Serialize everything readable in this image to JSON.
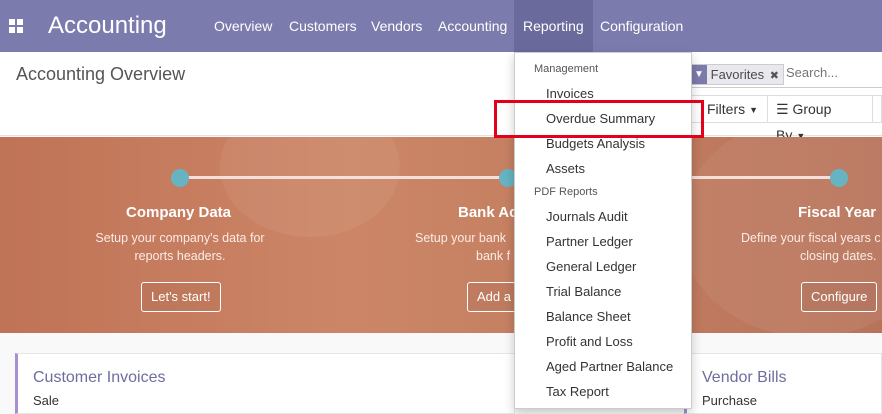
{
  "navbar": {
    "app_title": "Accounting",
    "menu": [
      "Overview",
      "Customers",
      "Vendors",
      "Accounting",
      "Reporting",
      "Configuration"
    ],
    "active_menu": "Reporting"
  },
  "control_panel": {
    "title": "Accounting Overview",
    "search": {
      "facet_label": "Favorites",
      "placeholder": "Search..."
    },
    "filters_label": "Filters",
    "group_by_label": "Group By"
  },
  "onboarding": {
    "steps": [
      {
        "title": "Company Data",
        "desc_line1": "Setup your company's data for",
        "desc_line2": "reports headers.",
        "button": "Let's start!"
      },
      {
        "title": "Bank Ac",
        "desc_line1": "Setup your bank",
        "desc_line2": "bank f",
        "button": "Add a"
      },
      {
        "title": "Fiscal Year",
        "desc_line1": "Define your fiscal years c",
        "desc_line2": "closing dates.",
        "button": "Configure"
      }
    ]
  },
  "dashboard": {
    "cards": [
      {
        "title": "Customer Invoices",
        "subtitle": "Sale"
      },
      {
        "title": "Vendor Bills",
        "subtitle": "Purchase"
      }
    ]
  },
  "reporting_menu": {
    "sections": [
      {
        "header": "Management",
        "items": [
          "Invoices",
          "Overdue Summary",
          "Budgets Analysis",
          "Assets"
        ]
      },
      {
        "header": "PDF Reports",
        "items": [
          "Journals Audit",
          "Partner Ledger",
          "General Ledger",
          "Trial Balance",
          "Balance Sheet",
          "Profit and Loss",
          "Aged Partner Balance",
          "Tax Report"
        ]
      }
    ],
    "highlighted_item": "Overdue Summary",
    "highlight_color": "#e2001a"
  },
  "colors": {
    "navbar": "#7c7bad",
    "banner": "#c8826a",
    "step_dot": "#66b3c1"
  }
}
